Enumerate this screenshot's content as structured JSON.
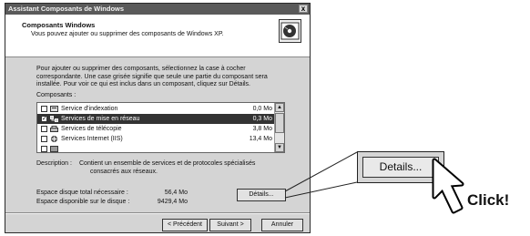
{
  "window": {
    "title": "Assistant Composants de Windows",
    "close_label": "x"
  },
  "header": {
    "title": "Composants Windows",
    "subtitle": "Vous pouvez ajouter ou supprimer des composants de Windows XP."
  },
  "intro": {
    "line1": "Pour ajouter ou supprimer des composants, sélectionnez la case à cocher",
    "line2": "correspondante. Une case grisée signifie que seule une partie du composant sera",
    "line3": "installée. Pour voir ce qui est inclus dans un composant, cliquez sur Détails."
  },
  "components": {
    "label": "Composants :",
    "items": [
      {
        "name": "Service d'indexation",
        "size": "0,0 Mo",
        "checked": false,
        "icon": "indexing-icon"
      },
      {
        "name": "Services de mise en réseau",
        "size": "0,3 Mo",
        "checked": true,
        "icon": "network-icon"
      },
      {
        "name": "Services de télécopie",
        "size": "3,8 Mo",
        "checked": false,
        "icon": "fax-icon"
      },
      {
        "name": "Services Internet (IIS)",
        "size": "13,4 Mo",
        "checked": false,
        "icon": "iis-icon"
      }
    ],
    "check_mark": "✓"
  },
  "description": {
    "label": "Description :",
    "line1": "Contient un ensemble de services et de protocoles spécialisés",
    "line2": "consacrés aux réseaux."
  },
  "space": {
    "required_label": "Espace disque total nécessaire :",
    "required_value": "56,4 Mo",
    "available_label": "Espace disponible sur le disque :",
    "available_value": "9429,4 Mo"
  },
  "buttons": {
    "details": "Détails...",
    "previous": "< Précédent",
    "next": "Suivant >",
    "cancel": "Annuler"
  },
  "zoom": {
    "details_label": "Details..."
  },
  "annotation": {
    "click_text": "Click!"
  }
}
